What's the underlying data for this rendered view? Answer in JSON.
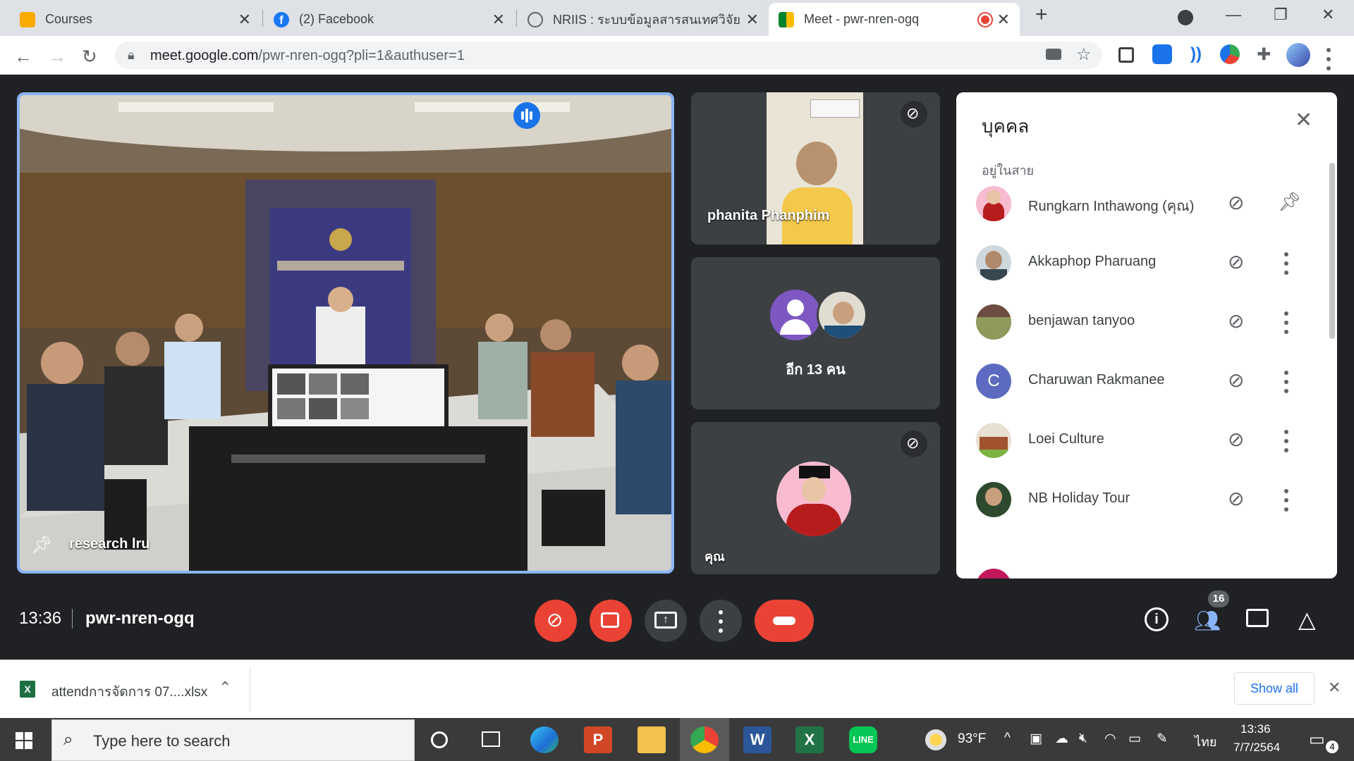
{
  "browser": {
    "tabs": [
      {
        "title": "Courses",
        "icon": "google-classroom-icon",
        "color": "#f9ab00"
      },
      {
        "title": "(2) Facebook",
        "icon": "facebook-icon",
        "color": "#1877f2"
      },
      {
        "title": "NRIIS : ระบบข้อมูลสารสนเทศวิจัยและ",
        "icon": "globe-icon",
        "color": "#5f6368"
      },
      {
        "title": "Meet - pwr-nren-ogq",
        "icon": "google-meet-icon",
        "color": "#00832d"
      }
    ],
    "url_host": "meet.google.com",
    "url_path": "/pwr-nren-ogq?pli=1&authuser=1",
    "recording_color": "#ea4335"
  },
  "meeting": {
    "main_tile": {
      "name": "research lru"
    },
    "tiles": [
      {
        "name": "phanita Phanphim"
      },
      {
        "name": "อีก 13 คน"
      },
      {
        "name": "คุณ"
      }
    ],
    "time": "13:36",
    "code": "pwr-nren-ogq",
    "participant_count": "16"
  },
  "people_panel": {
    "title": "บุคคล",
    "section": "อยู่ในสาย",
    "participants": [
      {
        "name": "Rungkarn Inthawong (คุณ)",
        "avatar": "photo",
        "color": "#b71c1c"
      },
      {
        "name": "Akkaphop Pharuang",
        "avatar": "photo",
        "color": "#37474f"
      },
      {
        "name": "benjawan tanyoo",
        "avatar": "photo",
        "color": "#6d4c41"
      },
      {
        "name": "Charuwan Rakmanee",
        "avatar": "C",
        "color": "#5c6bc0"
      },
      {
        "name": "Loei Culture",
        "avatar": "photo",
        "color": "#8d6e63"
      },
      {
        "name": "NB Holiday Tour",
        "avatar": "photo",
        "color": "#2e4a2e"
      }
    ]
  },
  "downloads": {
    "file": "attendการจัดการ 07....xlsx",
    "show_all": "Show all"
  },
  "taskbar": {
    "search_placeholder": "Type here to search",
    "weather": "93°F",
    "lang": "ไทย",
    "time": "13:36",
    "date": "7/7/2564",
    "notification_count": "4"
  },
  "colors": {
    "accent_blue": "#8ab4f8",
    "red": "#ea4335",
    "meet_bg": "#202124",
    "tile_bg": "#3c4043"
  }
}
